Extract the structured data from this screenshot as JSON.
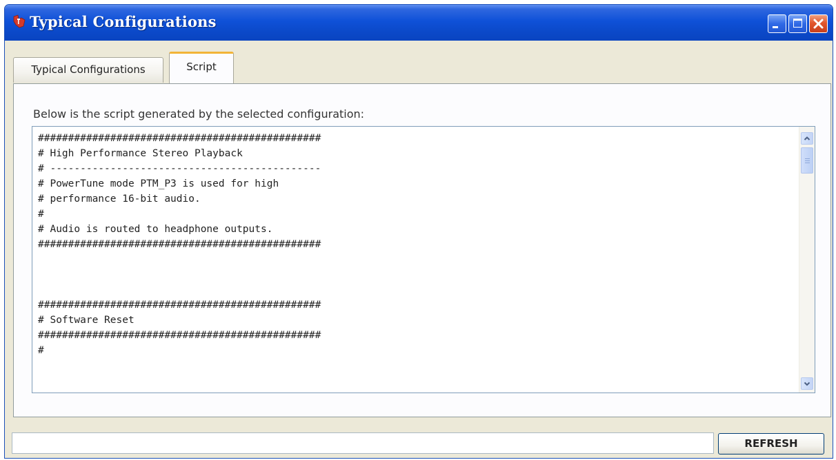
{
  "window": {
    "title": "Typical Configurations"
  },
  "tabs": [
    {
      "label": "Typical Configurations",
      "selected": false
    },
    {
      "label": "Script",
      "selected": true
    }
  ],
  "script_panel": {
    "description": "Below is the script generated by the selected configuration:",
    "lines": [
      "###############################################",
      "# High Performance Stereo Playback",
      "# ---------------------------------------------",
      "# PowerTune mode PTM_P3 is used for high",
      "# performance 16-bit audio.",
      "#",
      "# Audio is routed to headphone outputs.",
      "###############################################",
      "",
      "",
      "",
      "###############################################",
      "# Software Reset",
      "###############################################",
      "#"
    ]
  },
  "status": {
    "value": ""
  },
  "buttons": {
    "refresh_label": "REFRESH"
  },
  "colors": {
    "titlebar": "#0b49c9",
    "window_bg": "#ece9d8",
    "tab_highlight": "#f2b437",
    "close_button": "#e2572d"
  },
  "icons": {
    "app": "ti-logo-icon",
    "minimize": "minimize-icon",
    "maximize": "maximize-icon",
    "close": "close-icon",
    "scroll_up": "chevron-up-icon",
    "scroll_down": "chevron-down-icon"
  }
}
